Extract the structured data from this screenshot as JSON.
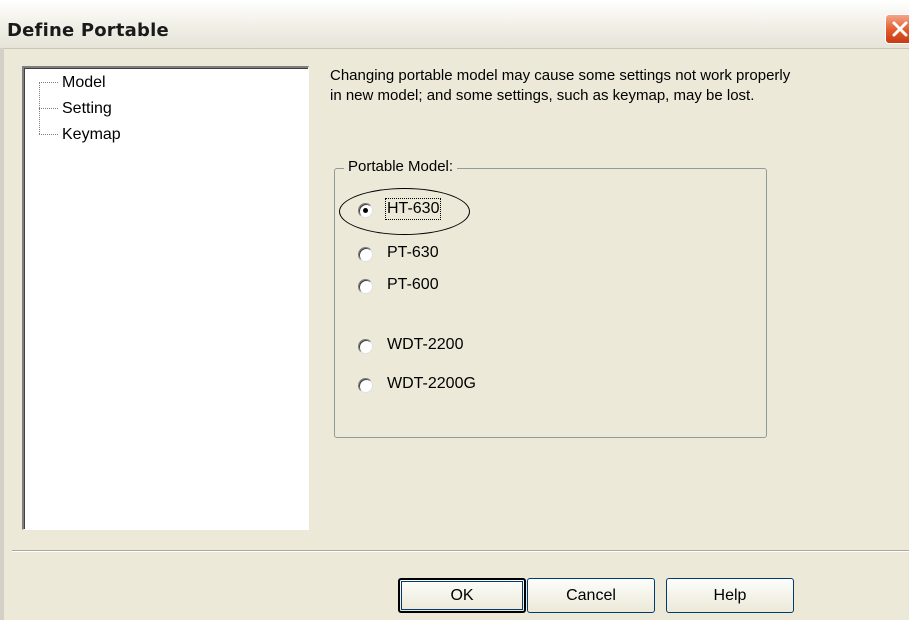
{
  "window": {
    "title": "Define Portable"
  },
  "tree": {
    "items": [
      {
        "label": "Model"
      },
      {
        "label": "Setting"
      },
      {
        "label": "Keymap"
      }
    ]
  },
  "description": {
    "line1": "Changing portable model may cause some settings not work properly",
    "line2": "in new model; and some settings, such as keymap, may be lost."
  },
  "portable_model": {
    "group_label": "Portable Model:",
    "selected": "HT-630",
    "options": [
      {
        "label": "HT-630",
        "checked": true
      },
      {
        "label": "PT-630",
        "checked": false
      },
      {
        "label": "PT-600",
        "checked": false
      },
      {
        "label": "WDT-2200",
        "checked": false
      },
      {
        "label": "WDT-2200G",
        "checked": false
      }
    ]
  },
  "buttons": {
    "ok": "OK",
    "cancel": "Cancel",
    "help": "Help"
  },
  "icons": {
    "close": "close-icon"
  },
  "colors": {
    "dialog_bg": "#ece9d8",
    "close_button": "#e25a2b",
    "button_border": "#003c74"
  }
}
